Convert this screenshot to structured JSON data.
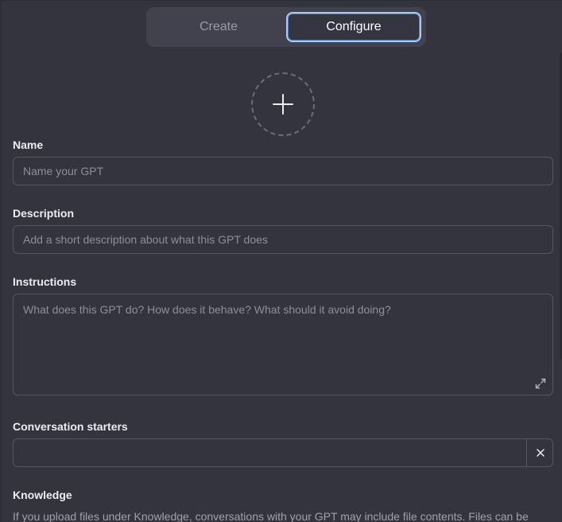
{
  "tabs": {
    "create": "Create",
    "configure": "Configure",
    "active": "configure"
  },
  "avatar": {
    "icon": "plus-icon"
  },
  "name": {
    "label": "Name",
    "placeholder": "Name your GPT",
    "value": ""
  },
  "description": {
    "label": "Description",
    "placeholder": "Add a short description about what this GPT does",
    "value": ""
  },
  "instructions": {
    "label": "Instructions",
    "placeholder": "What does this GPT do? How does it behave? What should it avoid doing?",
    "value": "",
    "expand_icon": "expand-icon"
  },
  "conversation_starters": {
    "label": "Conversation starters",
    "items": [
      ""
    ],
    "remove_icon": "close-icon"
  },
  "knowledge": {
    "label": "Knowledge",
    "description": "If you upload files under Knowledge, conversations with your GPT may include file contents. Files can be"
  },
  "colors": {
    "background": "#34343f",
    "accent_border": "#a9c8f6",
    "field_border": "#565663"
  }
}
